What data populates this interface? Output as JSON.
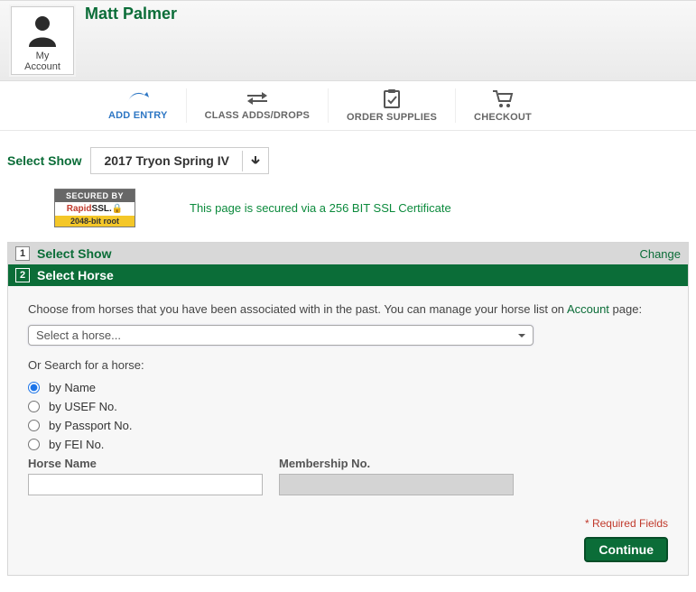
{
  "user": {
    "name": "Matt Palmer",
    "my_account_label": "My Account"
  },
  "nav": {
    "add_entry": "ADD ENTRY",
    "class_adds_drops": "CLASS ADDS/DROPS",
    "order_supplies": "ORDER SUPPLIES",
    "checkout": "CHECKOUT"
  },
  "show": {
    "label": "Select Show",
    "value": "2017 Tryon Spring IV"
  },
  "ssl": {
    "badge_top": "SECURED BY",
    "badge_mid_r": "Rapid",
    "badge_mid_s": "SSL.",
    "badge_bot": "2048-bit root",
    "text": "This page is secured via a 256 BIT SSL Certificate"
  },
  "steps": {
    "step1_num": "1",
    "step1_title": "Select Show",
    "step1_change": "Change",
    "step2_num": "2",
    "step2_title": "Select Horse"
  },
  "horse": {
    "instr_pre": "Choose from horses that you have been associated with in the past. You can manage your horse list on ",
    "instr_link": "Account",
    "instr_post": " page:",
    "select_placeholder": "Select a horse...",
    "or_search": "Or Search for a horse:",
    "options": {
      "by_name": "by Name",
      "by_usef": "by USEF No.",
      "by_passport": "by Passport No.",
      "by_fei": "by FEI No."
    },
    "horse_name_label": "Horse Name",
    "membership_no_label": "Membership No.",
    "horse_name_value": "",
    "membership_no_value": ""
  },
  "footer": {
    "required": "* Required Fields",
    "continue": "Continue"
  }
}
